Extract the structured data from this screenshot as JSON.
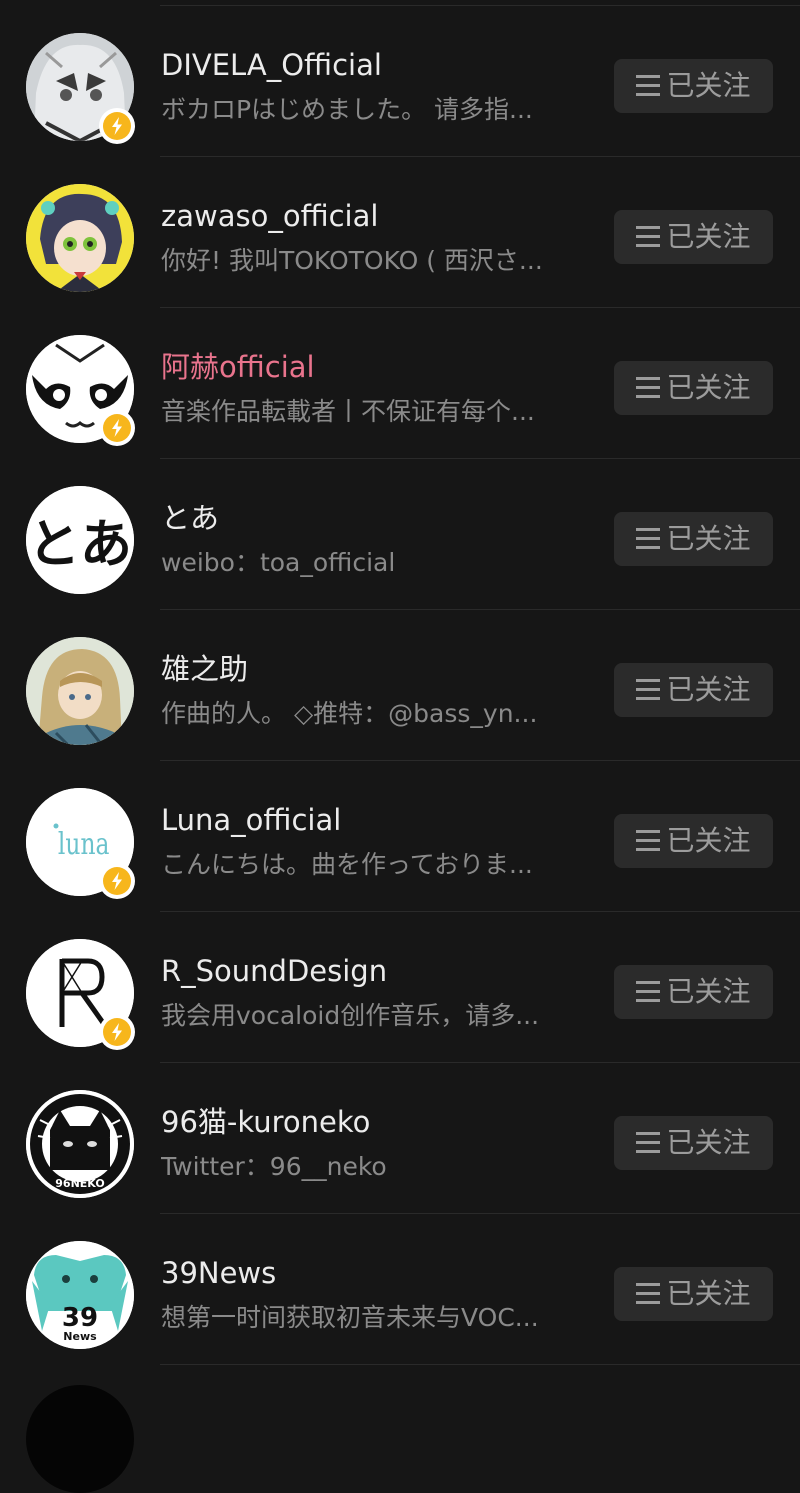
{
  "follow_list": {
    "button_label": "已关注",
    "items": [
      {
        "name": "DIVELA_Official",
        "bio": "ボカロPはじめました。 请多指...",
        "verified": true,
        "name_color": "#ececec"
      },
      {
        "name": "zawaso_official",
        "bio": "你好! 我叫TOKOTOKO ( 西沢さ...",
        "verified": false,
        "name_color": "#ececec"
      },
      {
        "name": "阿赫official",
        "bio": "音楽作品転載者丨不保证有每个...",
        "verified": true,
        "name_color": "#e9748d"
      },
      {
        "name": "とあ",
        "bio": "weibo：toa_official",
        "verified": false,
        "name_color": "#ececec"
      },
      {
        "name": "雄之助",
        "bio": "作曲的人。 ◇推特：@bass_yn...",
        "verified": false,
        "name_color": "#ececec"
      },
      {
        "name": "Luna_official",
        "bio": "こんにちは。曲を作っておりま...",
        "verified": true,
        "name_color": "#ececec"
      },
      {
        "name": "R_SoundDesign",
        "bio": "我会用vocaloid创作音乐，请多...",
        "verified": true,
        "name_color": "#ececec"
      },
      {
        "name": "96猫-kuroneko",
        "bio": "Twitter：96__neko",
        "verified": false,
        "name_color": "#ececec"
      },
      {
        "name": "39News",
        "bio": "想第一时间获取初音未来与VOC...",
        "verified": false,
        "name_color": "#ececec"
      }
    ]
  },
  "avatars": {
    "toa_text": "とあ",
    "luna_text": "luna",
    "kuroneko_text": "96NEKO",
    "news_number": "39",
    "news_word": "News"
  },
  "icons": {
    "verified_badge": "lightning-icon",
    "button_glyph": "menu-lines-icon"
  },
  "colors": {
    "background": "#161616",
    "button_bg": "#2b2b2b",
    "badge": "#f7b61c",
    "highlight_name": "#e9748d"
  }
}
